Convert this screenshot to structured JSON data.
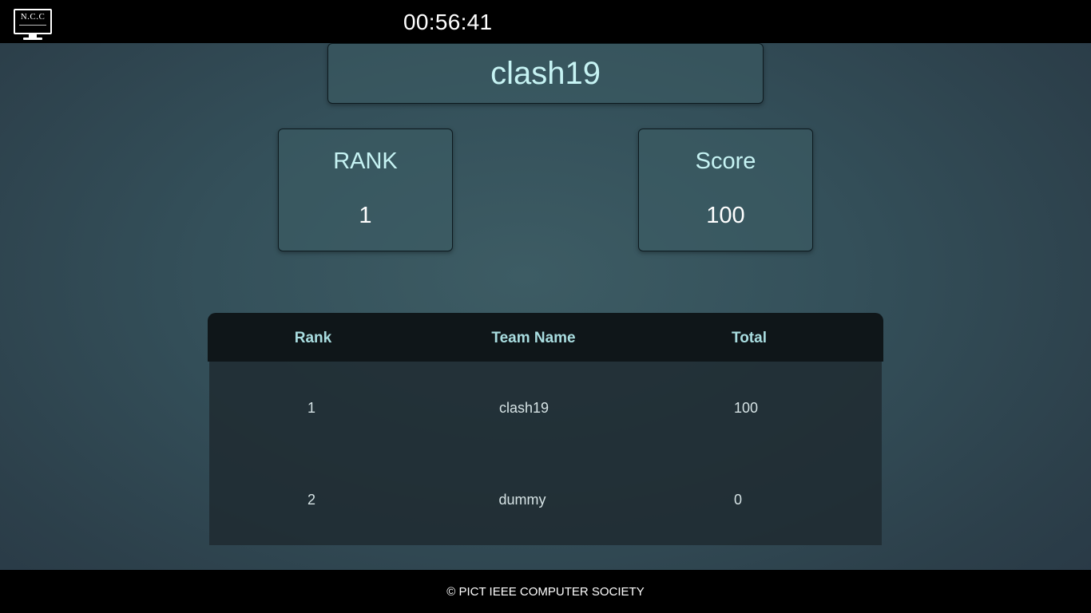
{
  "header": {
    "logo_text": "N.C.C",
    "timer": "00:56:41"
  },
  "team": {
    "name": "clash19"
  },
  "stats": {
    "rank_label": "RANK",
    "rank_value": "1",
    "score_label": "Score",
    "score_value": "100"
  },
  "leaderboard": {
    "columns": [
      "Rank",
      "Team Name",
      "Total"
    ],
    "rows": [
      {
        "rank": "1",
        "team": "clash19",
        "total": "100"
      },
      {
        "rank": "2",
        "team": "dummy",
        "total": "0"
      }
    ]
  },
  "footer": {
    "text": "© PICT IEEE COMPUTER SOCIETY"
  }
}
